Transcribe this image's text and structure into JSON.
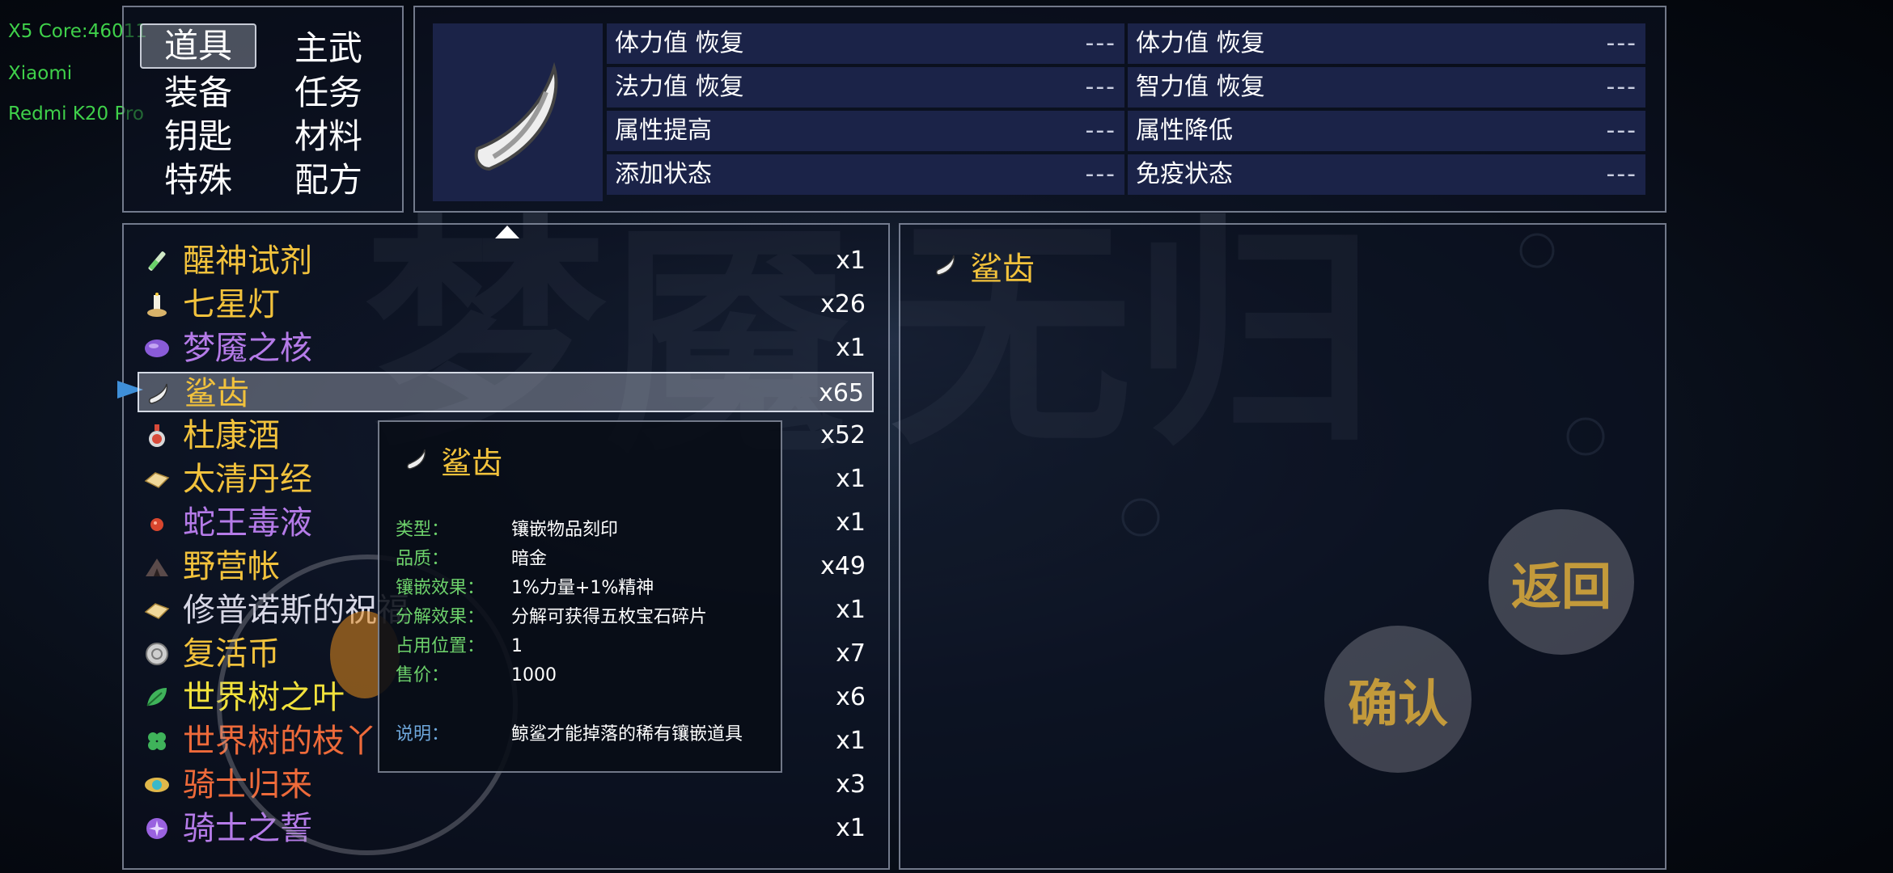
{
  "device": {
    "line1": "X5 Core:46011",
    "line2": "Xiaomi",
    "line3": "Redmi K20 Pro",
    "color": "#3fd14a"
  },
  "categories": [
    {
      "label": "道具",
      "selected": true
    },
    {
      "label": "主武",
      "selected": false
    },
    {
      "label": "装备",
      "selected": false
    },
    {
      "label": "任务",
      "selected": false
    },
    {
      "label": "钥匙",
      "selected": false
    },
    {
      "label": "材料",
      "selected": false
    },
    {
      "label": "特殊",
      "selected": false
    },
    {
      "label": "配方",
      "selected": false
    }
  ],
  "stats": [
    {
      "label": "体力值 恢复",
      "value": "---"
    },
    {
      "label": "体力值 恢复",
      "value": "---"
    },
    {
      "label": "法力值 恢复",
      "value": "---"
    },
    {
      "label": "智力值 恢复",
      "value": "---"
    },
    {
      "label": "属性提高",
      "value": "---"
    },
    {
      "label": "属性降低",
      "value": "---"
    },
    {
      "label": "添加状态",
      "value": "---"
    },
    {
      "label": "免疫状态",
      "value": "---"
    }
  ],
  "items": [
    {
      "name": "醒神试剂",
      "qty": "x1",
      "color": "#f2c23c",
      "icon": "potion-icon"
    },
    {
      "name": "七星灯",
      "qty": "x26",
      "color": "#f2c23c",
      "icon": "candle-icon"
    },
    {
      "name": "梦魇之核",
      "qty": "x1",
      "color": "#b57be8",
      "icon": "purple-gem-icon"
    },
    {
      "name": "鲨齿",
      "qty": "x65",
      "color": "#f2c23c",
      "icon": "tooth-icon",
      "selected": true
    },
    {
      "name": "杜康酒",
      "qty": "x52",
      "color": "#f2c23c",
      "icon": "wine-icon"
    },
    {
      "name": "太清丹经",
      "qty": "x1",
      "color": "#f2c23c",
      "icon": "scroll-icon"
    },
    {
      "name": "蛇王毒液",
      "qty": "x1",
      "color": "#b57be8",
      "icon": "venom-icon"
    },
    {
      "name": "野营帐",
      "qty": "x49",
      "color": "#f2c23c",
      "icon": "tent-icon"
    },
    {
      "name": "修普诺斯的祝福",
      "qty": "x1",
      "color": "#d8d8e6",
      "icon": "scroll-icon"
    },
    {
      "name": "复活币",
      "qty": "x7",
      "color": "#f2c23c",
      "icon": "coin-icon"
    },
    {
      "name": "世界树之叶",
      "qty": "x6",
      "color": "#f2e23c",
      "icon": "leaf-icon"
    },
    {
      "name": "世界树的枝丫",
      "qty": "x1",
      "color": "#ee6a3a",
      "icon": "clover-icon"
    },
    {
      "name": "骑士归来",
      "qty": "x3",
      "color": "#ee6a3a",
      "icon": "eye-gem-icon"
    },
    {
      "name": "骑士之誓",
      "qty": "x1",
      "color": "#b57be8",
      "icon": "orb-icon"
    }
  ],
  "detail": {
    "name": "鲨齿",
    "color": "#f2c23c"
  },
  "tooltip": {
    "name": "鲨齿",
    "rows": [
      {
        "key": "类型：",
        "value": "镶嵌物品刻印"
      },
      {
        "key": "品质：",
        "value": "暗金"
      },
      {
        "key": "镶嵌效果：",
        "value": "1%力量+1%精神"
      },
      {
        "key": "分解效果：",
        "value": "分解可获得五枚宝石碎片"
      },
      {
        "key": "占用位置：",
        "value": "1"
      },
      {
        "key": "售价：",
        "value": "1000"
      },
      {
        "key": "说明：",
        "value": "鲸鲨才能掉落的稀有镶嵌道具"
      }
    ]
  },
  "buttons": {
    "back": "返回",
    "confirm": "确认"
  },
  "colors": {
    "accent": "#f2c23c",
    "stat_bg": "#1b2348",
    "button_text": "#c39a3b"
  }
}
